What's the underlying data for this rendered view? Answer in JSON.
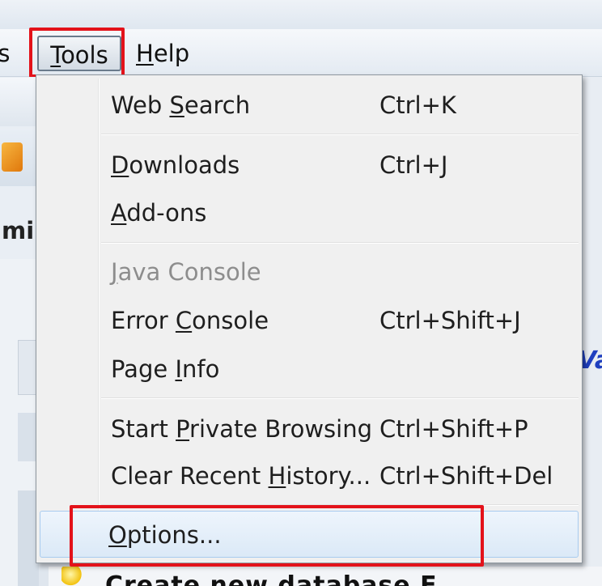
{
  "menubar": {
    "previous_item_fragment": "ts",
    "tools_label": "Tools",
    "tools_underline": "T",
    "help_label": "Help",
    "help_underline": "H"
  },
  "background": {
    "title_fragment": "mi",
    "link_fragment": "Va",
    "bottom_text": "Create new database E"
  },
  "tools_menu": {
    "items": [
      {
        "pre": "Web ",
        "u": "S",
        "post": "earch",
        "shortcut": "Ctrl+K",
        "enabled": true
      },
      {
        "pre": "",
        "u": "D",
        "post": "ownloads",
        "shortcut": "Ctrl+J",
        "enabled": true
      },
      {
        "pre": "",
        "u": "A",
        "post": "dd-ons",
        "shortcut": "",
        "enabled": true
      },
      {
        "pre": "",
        "u": "J",
        "post": "ava Console",
        "shortcut": "",
        "enabled": false
      },
      {
        "pre": "Error ",
        "u": "C",
        "post": "onsole",
        "shortcut": "Ctrl+Shift+J",
        "enabled": true
      },
      {
        "pre": "Page ",
        "u": "I",
        "post": "nfo",
        "shortcut": "",
        "enabled": true
      },
      {
        "pre": "Start ",
        "u": "P",
        "post": "rivate Browsing",
        "shortcut": "Ctrl+Shift+P",
        "enabled": true
      },
      {
        "pre": "Clear Recent ",
        "u": "H",
        "post": "istory...",
        "shortcut": "Ctrl+Shift+Del",
        "enabled": true
      },
      {
        "pre": "",
        "u": "O",
        "post": "ptions...",
        "shortcut": "",
        "enabled": true,
        "hovered": true
      }
    ]
  },
  "colors": {
    "highlight_box": "#e3121a",
    "menu_background": "#f0f0f0",
    "hover_background": "#dbe9f7",
    "disabled_text": "#8d8d8d"
  }
}
